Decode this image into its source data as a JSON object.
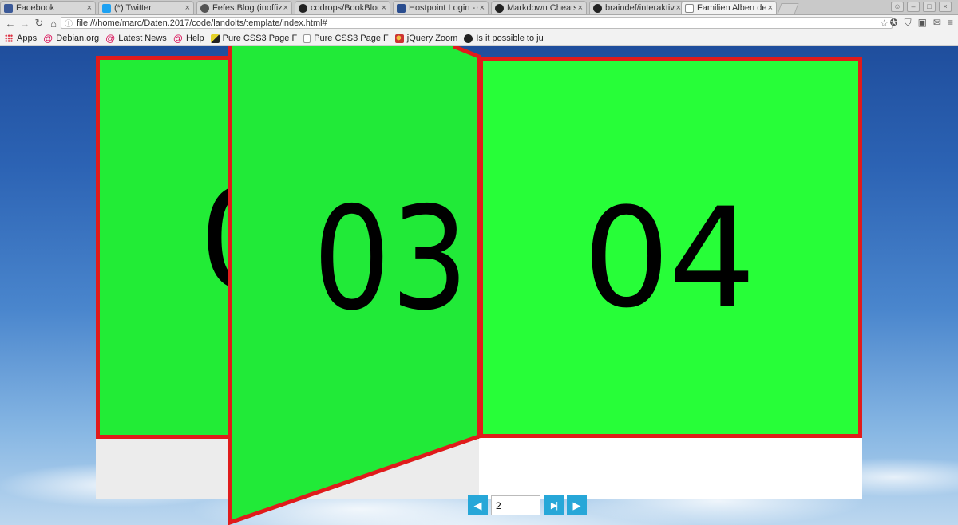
{
  "browser": {
    "tabs": [
      {
        "title": "Facebook",
        "icon": "facebook-icon",
        "color": "#3b5998",
        "active": false
      },
      {
        "title": "(*) Twitter",
        "icon": "twitter-icon",
        "color": "#1da1f2",
        "active": false
      },
      {
        "title": "Fefes Blog (inoffizie",
        "icon": "fefe-icon",
        "color": "#555555",
        "active": false
      },
      {
        "title": "codrops/BookBlock",
        "icon": "github-icon",
        "color": "#222222",
        "active": false
      },
      {
        "title": "Hostpoint Login - C",
        "icon": "hostpoint-icon",
        "color": "#2a4d8f",
        "active": false
      },
      {
        "title": "Markdown Cheatshe",
        "icon": "github-icon",
        "color": "#222222",
        "active": false
      },
      {
        "title": "braindef/interaktives",
        "icon": "github-icon",
        "color": "#222222",
        "active": false
      },
      {
        "title": "Familien Alben der F",
        "icon": "page-icon",
        "color": "#888888",
        "active": true
      }
    ],
    "url": "file:///home/marc/Daten.2017/code/landolts/template/index.html#",
    "bookmarks": [
      {
        "label": "Apps",
        "icon": "apps-icon"
      },
      {
        "label": "Debian.org",
        "icon": "debian-icon",
        "color": "#d70751"
      },
      {
        "label": "Latest News",
        "icon": "debian-icon",
        "color": "#d70751"
      },
      {
        "label": "Help",
        "icon": "debian-icon",
        "color": "#d70751"
      },
      {
        "label": "Pure CSS3 Page F",
        "icon": "css3-icon",
        "color": "#2b2b2b"
      },
      {
        "label": "Pure CSS3 Page F",
        "icon": "page-icon",
        "color": "#888888"
      },
      {
        "label": "jQuery Zoom",
        "icon": "jquery-icon",
        "color": "#cc3333"
      },
      {
        "label": "Is it possible to ju",
        "icon": "github-icon",
        "color": "#222222"
      }
    ]
  },
  "book": {
    "left_page_number": "0",
    "flipping_page_number": "03",
    "right_page_number": "04",
    "page_color": "#22ee33",
    "border_color": "#e01b1b"
  },
  "navigation": {
    "prev_icon": "triangle-left-icon",
    "page_input_value": "2",
    "last_icon": "skip-last-icon",
    "next_icon": "triangle-right-icon",
    "button_color": "#27a7d8"
  }
}
